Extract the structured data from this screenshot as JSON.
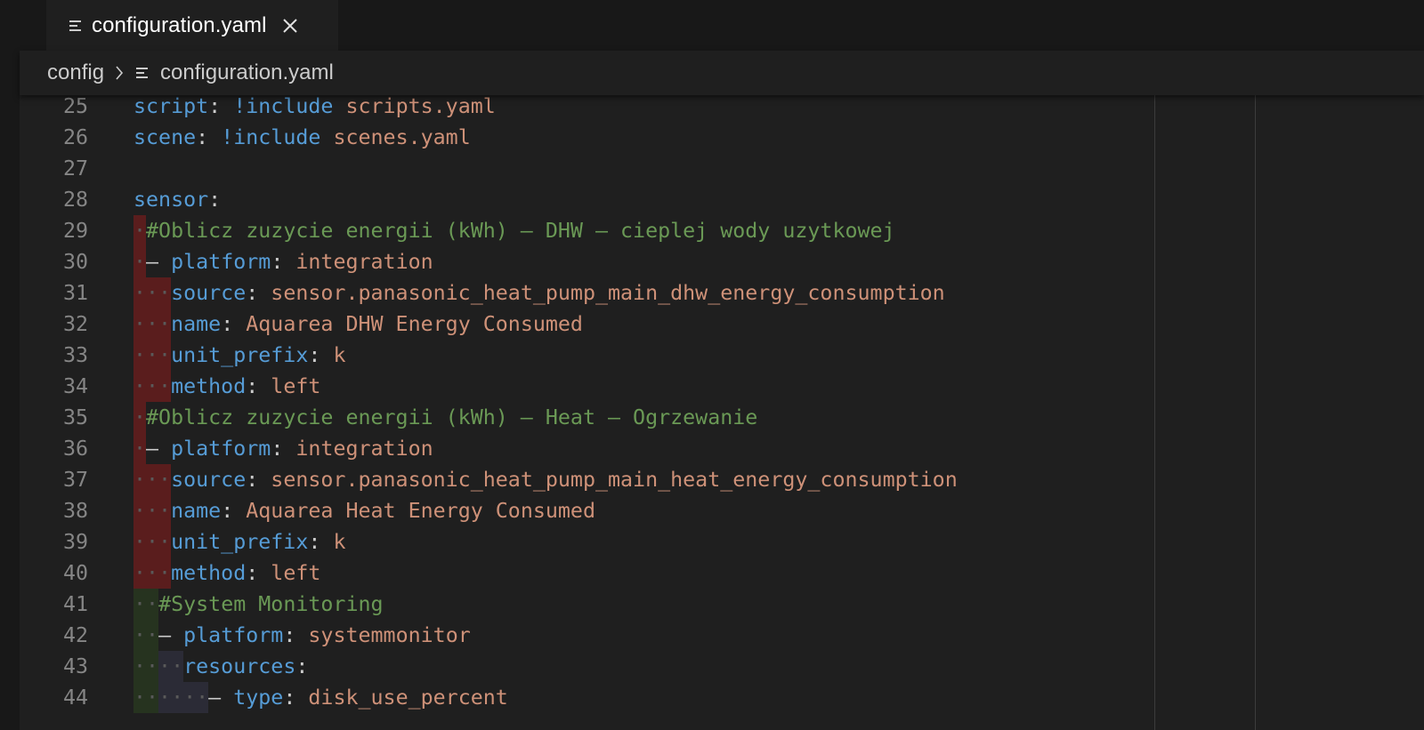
{
  "tab": {
    "label": "configuration.yaml",
    "icon": "lines-file-icon",
    "close_icon": "close-icon"
  },
  "breadcrumb": {
    "folder": "config",
    "file": "configuration.yaml",
    "separator_icon": "chevron-right-icon"
  },
  "colors": {
    "background": "#1f1f1f",
    "chrome": "#181818",
    "line_number": "#858585",
    "key": "#569cd6",
    "string": "#ce9178",
    "comment": "#6a9955",
    "whitespace": "#5a5a5a",
    "indent_error": "#5a1d1d",
    "indent_ok": "#26331f"
  },
  "editor": {
    "lines": [
      {
        "number": "25",
        "indent": "",
        "tokens": [
          {
            "t": "script",
            "c": "k"
          },
          {
            "t": ": ",
            "c": "p"
          },
          {
            "t": "!include",
            "c": "k"
          },
          {
            "t": " scripts.yaml",
            "c": "s"
          }
        ]
      },
      {
        "number": "26",
        "indent": "",
        "tokens": [
          {
            "t": "scene",
            "c": "k"
          },
          {
            "t": ": ",
            "c": "p"
          },
          {
            "t": "!include",
            "c": "k"
          },
          {
            "t": " scenes.yaml",
            "c": "s"
          }
        ]
      },
      {
        "number": "27",
        "indent": "",
        "tokens": []
      },
      {
        "number": "28",
        "indent": "",
        "tokens": [
          {
            "t": "sensor",
            "c": "k"
          },
          {
            "t": ":",
            "c": "p"
          }
        ]
      },
      {
        "number": "29",
        "indent": "·",
        "tokens": [
          {
            "t": "#Oblicz zuzycie energii (kWh) – DHW – cieplej wody uzytkowej",
            "c": "c"
          }
        ]
      },
      {
        "number": "30",
        "indent": "·",
        "tokens": [
          {
            "t": "– ",
            "c": "p"
          },
          {
            "t": "platform",
            "c": "k"
          },
          {
            "t": ": ",
            "c": "p"
          },
          {
            "t": "integration",
            "c": "s"
          }
        ]
      },
      {
        "number": "31",
        "indent": "···",
        "tokens": [
          {
            "t": "source",
            "c": "k"
          },
          {
            "t": ": ",
            "c": "p"
          },
          {
            "t": "sensor.panasonic_heat_pump_main_dhw_energy_consumption",
            "c": "s"
          }
        ]
      },
      {
        "number": "32",
        "indent": "···",
        "tokens": [
          {
            "t": "name",
            "c": "k"
          },
          {
            "t": ": ",
            "c": "p"
          },
          {
            "t": "Aquarea DHW Energy Consumed",
            "c": "s"
          }
        ]
      },
      {
        "number": "33",
        "indent": "···",
        "tokens": [
          {
            "t": "unit_prefix",
            "c": "k"
          },
          {
            "t": ": ",
            "c": "p"
          },
          {
            "t": "k",
            "c": "s"
          }
        ]
      },
      {
        "number": "34",
        "indent": "···",
        "tokens": [
          {
            "t": "method",
            "c": "k"
          },
          {
            "t": ": ",
            "c": "p"
          },
          {
            "t": "left",
            "c": "s"
          }
        ]
      },
      {
        "number": "35",
        "indent": "·",
        "tokens": [
          {
            "t": "#Oblicz zuzycie energii (kWh) – Heat – Ogrzewanie",
            "c": "c"
          }
        ]
      },
      {
        "number": "36",
        "indent": "·",
        "tokens": [
          {
            "t": "– ",
            "c": "p"
          },
          {
            "t": "platform",
            "c": "k"
          },
          {
            "t": ": ",
            "c": "p"
          },
          {
            "t": "integration",
            "c": "s"
          }
        ]
      },
      {
        "number": "37",
        "indent": "···",
        "tokens": [
          {
            "t": "source",
            "c": "k"
          },
          {
            "t": ": ",
            "c": "p"
          },
          {
            "t": "sensor.panasonic_heat_pump_main_heat_energy_consumption",
            "c": "s"
          }
        ]
      },
      {
        "number": "38",
        "indent": "···",
        "tokens": [
          {
            "t": "name",
            "c": "k"
          },
          {
            "t": ": ",
            "c": "p"
          },
          {
            "t": "Aquarea Heat Energy Consumed",
            "c": "s"
          }
        ]
      },
      {
        "number": "39",
        "indent": "···",
        "tokens": [
          {
            "t": "unit_prefix",
            "c": "k"
          },
          {
            "t": ": ",
            "c": "p"
          },
          {
            "t": "k",
            "c": "s"
          }
        ]
      },
      {
        "number": "40",
        "indent": "···",
        "tokens": [
          {
            "t": "method",
            "c": "k"
          },
          {
            "t": ": ",
            "c": "p"
          },
          {
            "t": "left",
            "c": "s"
          }
        ]
      },
      {
        "number": "41",
        "indent": "··",
        "tokens": [
          {
            "t": "#System Monitoring",
            "c": "c"
          }
        ]
      },
      {
        "number": "42",
        "indent": "··",
        "tokens": [
          {
            "t": "– ",
            "c": "p"
          },
          {
            "t": "platform",
            "c": "k"
          },
          {
            "t": ": ",
            "c": "p"
          },
          {
            "t": "systemmonitor",
            "c": "s"
          }
        ]
      },
      {
        "number": "43",
        "indent": "····",
        "tokens": [
          {
            "t": "resources",
            "c": "k"
          },
          {
            "t": ":",
            "c": "p"
          }
        ]
      },
      {
        "number": "44",
        "indent": "······",
        "tokens": [
          {
            "t": "– ",
            "c": "p"
          },
          {
            "t": "type",
            "c": "k"
          },
          {
            "t": ": ",
            "c": "p"
          },
          {
            "t": "disk_use_percent",
            "c": "s"
          }
        ]
      }
    ]
  }
}
